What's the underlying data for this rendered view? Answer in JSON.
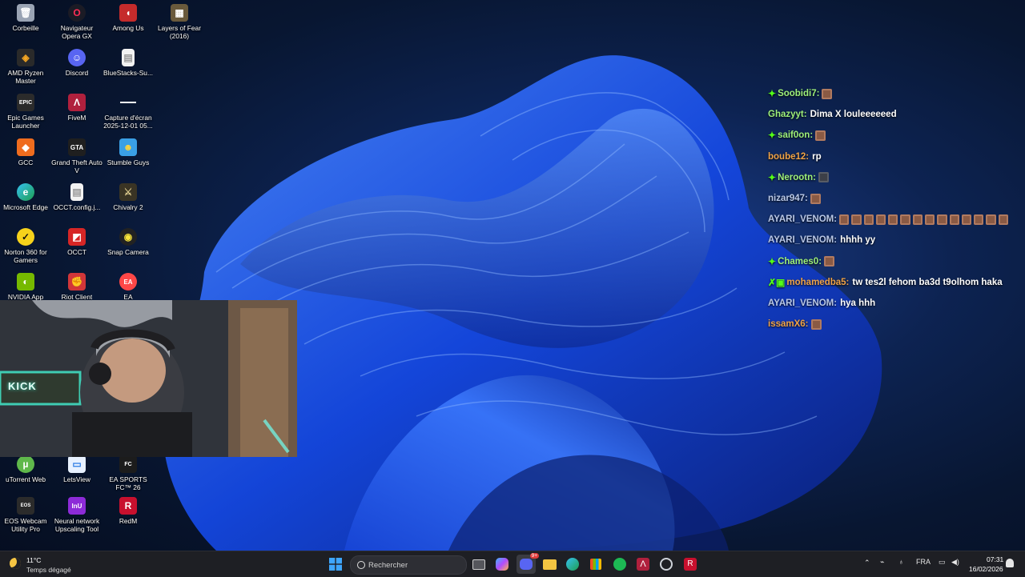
{
  "desktop": {
    "icons": [
      {
        "label": "Corbeille"
      },
      {
        "label": "Navigateur Opera GX"
      },
      {
        "label": "Among Us"
      },
      {
        "label": "Layers of Fear (2016)"
      },
      {
        "label": "AMD Ryzen Master"
      },
      {
        "label": "Discord"
      },
      {
        "label": "BlueStacks-Su..."
      },
      {
        "label": "Epic Games Launcher"
      },
      {
        "label": "FiveM"
      },
      {
        "label": "Capture d'écran 2025-12-01 05..."
      },
      {
        "label": "GCC"
      },
      {
        "label": "Grand Theft Auto V"
      },
      {
        "label": "Stumble Guys"
      },
      {
        "label": "Microsoft Edge"
      },
      {
        "label": "OCCT.config.j..."
      },
      {
        "label": "Chivalry 2"
      },
      {
        "label": "Norton 360 for Gamers"
      },
      {
        "label": "OCCT"
      },
      {
        "label": "Snap Camera"
      },
      {
        "label": "NVIDIA App"
      },
      {
        "label": "Riot Client"
      },
      {
        "label": "EA"
      },
      {
        "label": "uTorrent Web"
      },
      {
        "label": "LetsView"
      },
      {
        "label": "EA SPORTS FC™ 26"
      },
      {
        "label": "EOS Webcam Utility Pro"
      },
      {
        "label": "Neural network Upscaling Tool"
      },
      {
        "label": "RedM"
      }
    ]
  },
  "webcam": {
    "overlay_text": "KICK"
  },
  "chat": {
    "messages": [
      {
        "badge": "✦",
        "user": "Soobidi7:",
        "text": "",
        "emotes": 1,
        "color": "#9ef07a"
      },
      {
        "badge": "",
        "user": "Ghazyyt:",
        "text": "Dima X louleeeeeed",
        "emotes": 0,
        "color": "#9ef07a"
      },
      {
        "badge": "✦",
        "user": "saif0on:",
        "text": "",
        "emotes": 1,
        "color": "#9ef07a"
      },
      {
        "badge": "",
        "user": "boube12:",
        "text": "rp",
        "emotes": 0,
        "color": "#f0a347"
      },
      {
        "badge": "✦",
        "user": "Nerootn:",
        "text": "",
        "emotes": 1,
        "color": "#9ef07a"
      },
      {
        "badge": "",
        "user": "nizar947:",
        "text": "",
        "emotes": 1,
        "color": "#b9c8e8"
      },
      {
        "badge": "",
        "user": "AYARI_VENOM:",
        "text": "",
        "emotes": 14,
        "color": "#b9c8e8"
      },
      {
        "badge": "",
        "user": "AYARI_VENOM:",
        "text": "hhhh yy",
        "emotes": 0,
        "color": "#b9c8e8"
      },
      {
        "badge": "✦",
        "user": "Chames0:",
        "text": "",
        "emotes": 1,
        "color": "#9ef07a"
      },
      {
        "badge": "✗▣",
        "user": "mohamedba5:",
        "text": "tw tes2l fehom ba3d t9olhom haka",
        "emotes": 0,
        "color": "#f0a347"
      },
      {
        "badge": "",
        "user": "AYARI_VENOM:",
        "text": "hya hhh",
        "emotes": 0,
        "color": "#b9c8e8"
      },
      {
        "badge": "",
        "user": "issamX6:",
        "text": "",
        "emotes": 1,
        "color": "#f0a347"
      }
    ]
  },
  "taskbar": {
    "weather_temp": "11°C",
    "weather_desc": "Temps dégagé",
    "search_placeholder": "Rechercher",
    "chat_badge": "9+",
    "language": "FRA",
    "time": "07:31",
    "date": "16/02/2026"
  }
}
